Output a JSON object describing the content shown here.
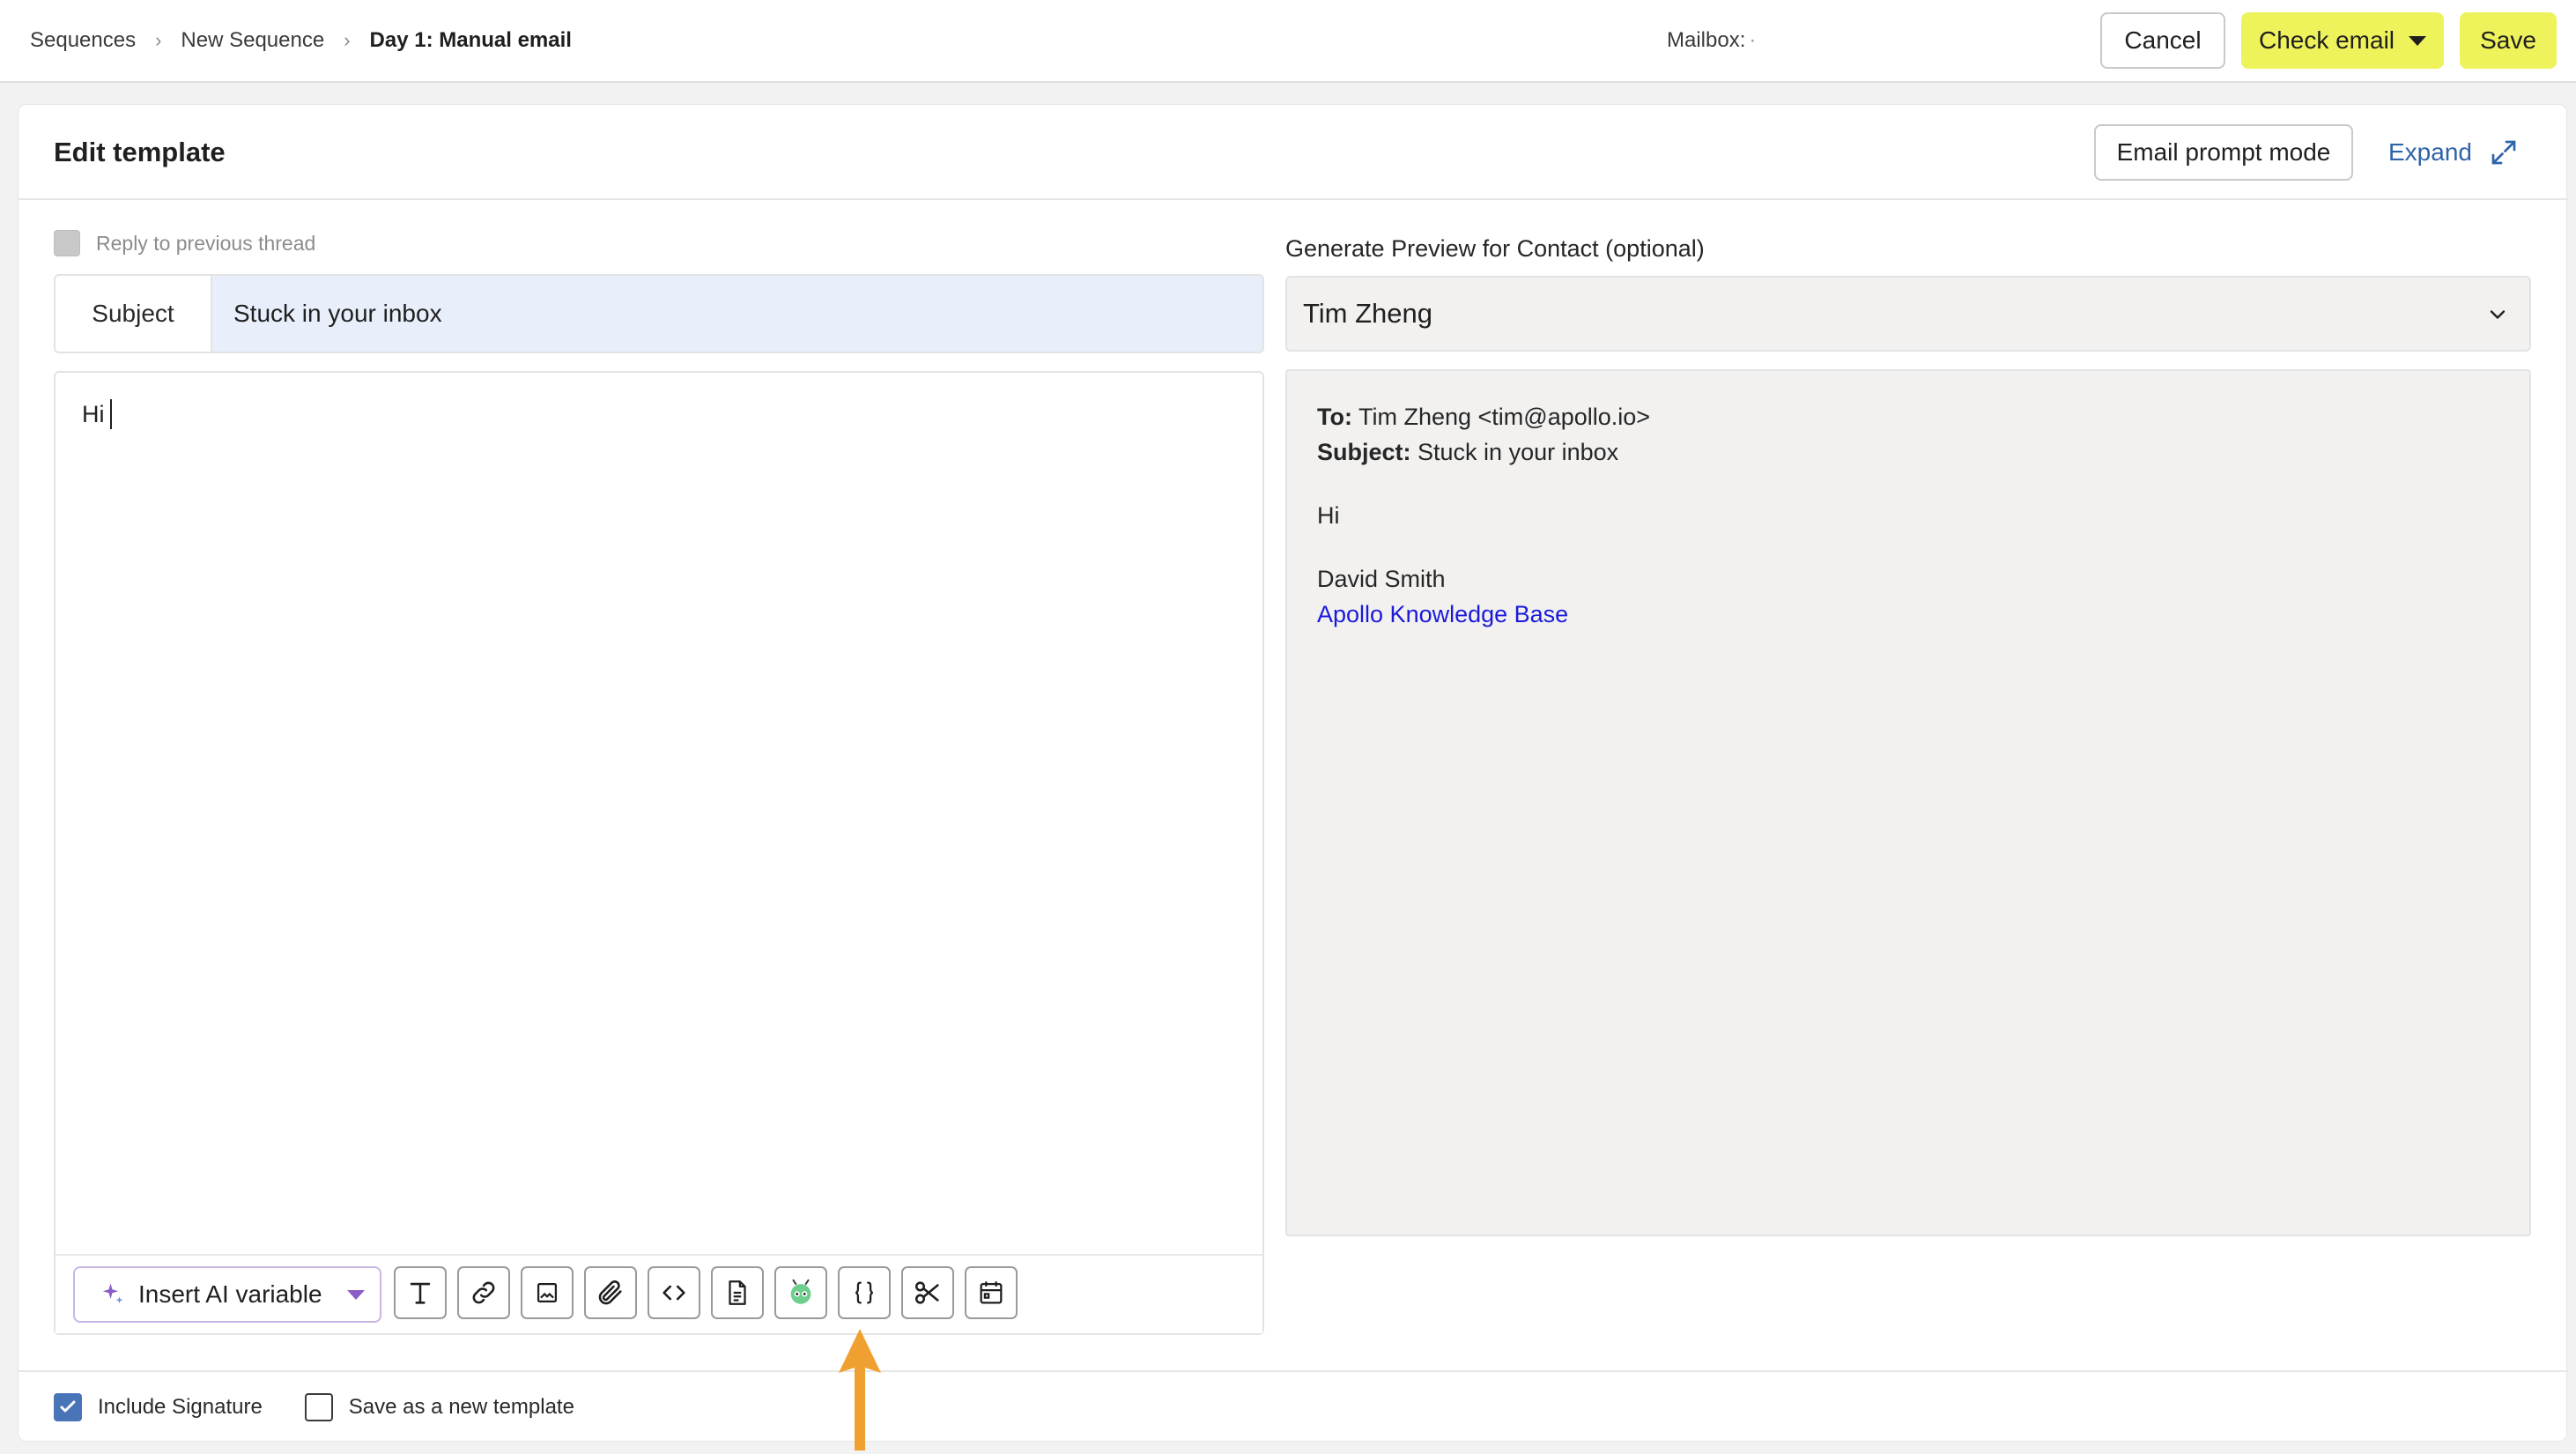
{
  "breadcrumb": {
    "items": [
      "Sequences",
      "New Sequence",
      "Day 1: Manual email"
    ],
    "separator": "›"
  },
  "mailbox": {
    "label": "Mailbox:",
    "value": "·"
  },
  "header_actions": {
    "cancel_label": "Cancel",
    "check_email_label": "Check email",
    "save_label": "Save"
  },
  "card": {
    "title": "Edit template",
    "prompt_mode_label": "Email prompt mode",
    "expand_label": "Expand"
  },
  "reply": {
    "label": "Reply to previous thread",
    "checked": false,
    "disabled": true
  },
  "subject": {
    "label": "Subject",
    "value": "Stuck in your inbox"
  },
  "editor": {
    "body": "Hi"
  },
  "toolbar": {
    "ai_variable_label": "Insert AI variable",
    "tools": [
      {
        "name": "text-format-icon"
      },
      {
        "name": "link-icon"
      },
      {
        "name": "image-icon"
      },
      {
        "name": "attachment-icon"
      },
      {
        "name": "code-icon"
      },
      {
        "name": "document-icon"
      },
      {
        "name": "ai-bot-icon"
      },
      {
        "name": "variable-braces-icon"
      },
      {
        "name": "scissors-icon"
      },
      {
        "name": "calendar-icon"
      }
    ]
  },
  "preview": {
    "label": "Generate Preview for Contact (optional)",
    "selected_contact": "Tim Zheng",
    "to_label": "To:",
    "to_value": "Tim Zheng <tim@apollo.io>",
    "subject_label": "Subject:",
    "subject_value": "Stuck in your inbox",
    "body": "Hi",
    "signature_name": "David Smith",
    "signature_link": "Apollo Knowledge Base"
  },
  "footer": {
    "include_signature_label": "Include Signature",
    "include_signature_checked": true,
    "save_template_label": "Save as a new template",
    "save_template_checked": false
  },
  "colors": {
    "accent_yellow": "#eef25b",
    "link_blue": "#2e64a8",
    "subject_bg": "#e8eefa",
    "preview_bg": "#f2f1f0",
    "arrow_orange": "#f0a030",
    "checkbox_blue": "#4a74b8"
  }
}
